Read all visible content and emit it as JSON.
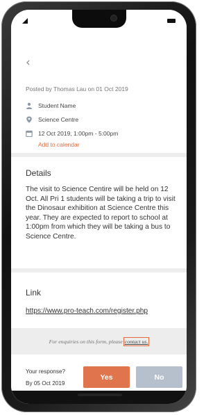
{
  "header": {
    "back_glyph": "‹"
  },
  "post": {
    "posted_by": "Posted by Thomas Lau on 01 Oct 2019",
    "student": "Student Name",
    "location": "Science Centre",
    "datetime": "12 Oct 2019, 1:00pm - 5:00pm",
    "add_to_calendar": "Add to calendar"
  },
  "details": {
    "heading": "Details",
    "body": "The visit to Science Centire will be held on 12 Oct. All Pri 1 students will be taking a trip to visit the Dinosaur exhibition at Science Centre this year. They are expected to report to school at 1:00pm from which they will be taking a bus to Science Centre."
  },
  "link": {
    "heading": "Link",
    "url": "https://www.pro-teach.com/register.php"
  },
  "enquiry": {
    "text": "For enquiries on this form, please",
    "contact_label": "contact us."
  },
  "response": {
    "question": "Your response?",
    "deadline": "By 05 Oct 2019",
    "yes_label": "Yes",
    "no_label": "No"
  },
  "colors": {
    "accent": "#e76a3c",
    "yes_button": "#e0744d",
    "no_button": "#b5c0cc",
    "background": "#ededed"
  },
  "icons": [
    "signal-icon",
    "battery-icon",
    "back-chevron-icon",
    "person-icon",
    "location-pin-icon",
    "calendar-icon"
  ]
}
